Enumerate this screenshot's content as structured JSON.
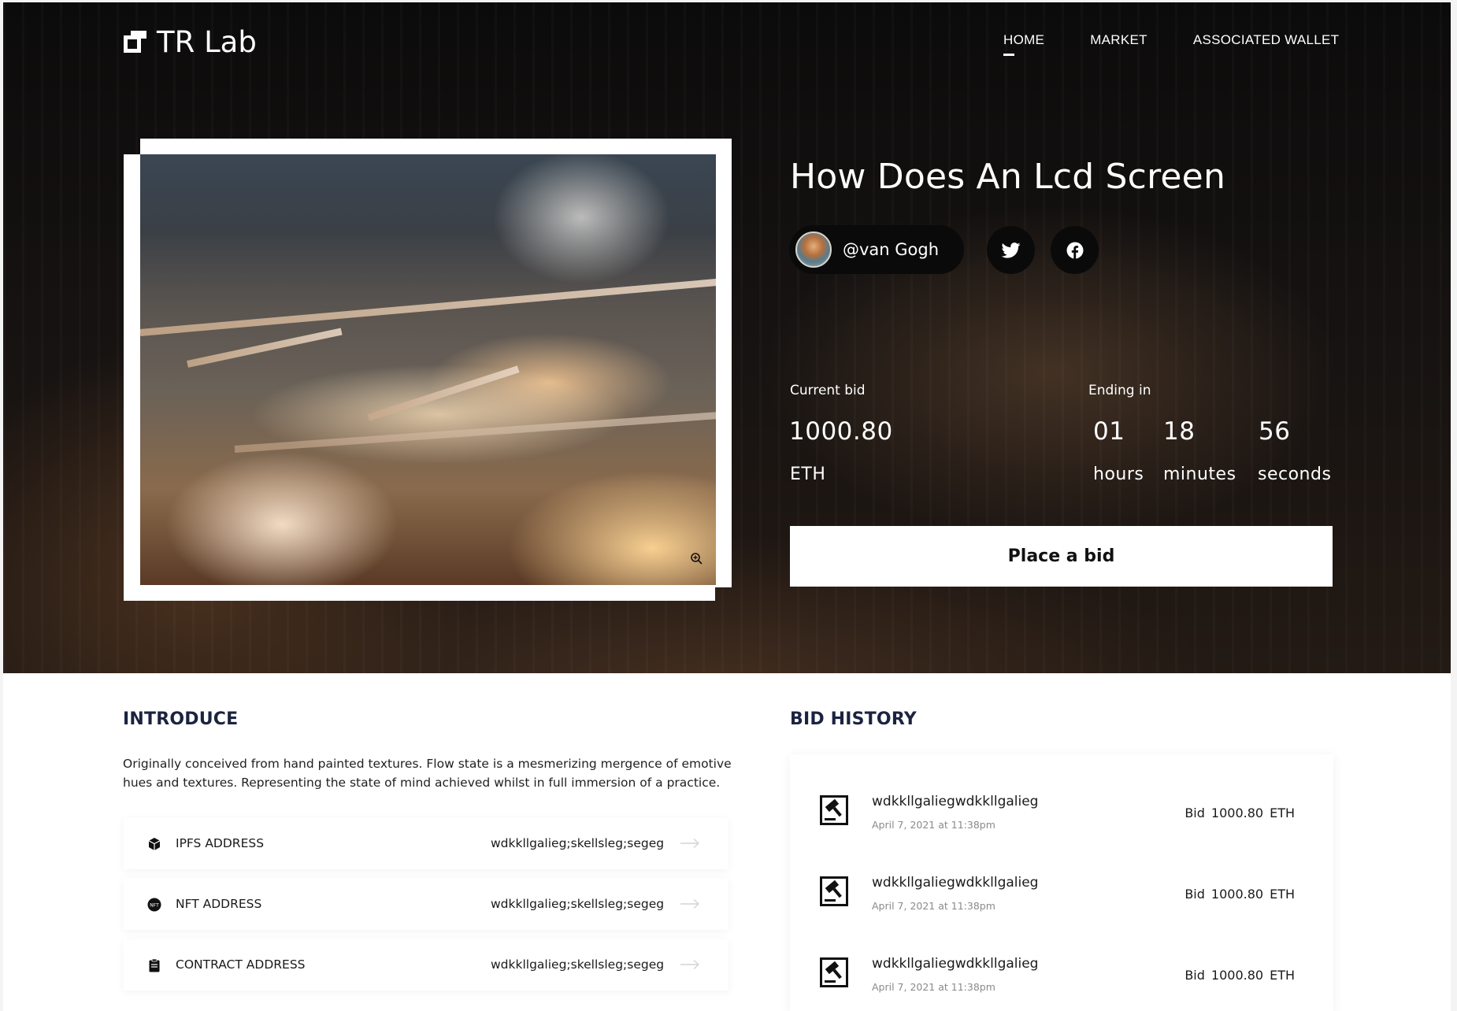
{
  "brand": {
    "name": "TR Lab"
  },
  "nav": {
    "items": [
      {
        "label": "HOME",
        "active": true
      },
      {
        "label": "MARKET",
        "active": false
      },
      {
        "label": "ASSOCIATED WALLET",
        "active": false
      }
    ]
  },
  "artwork": {
    "title": "How Does An Lcd Screen"
  },
  "author": {
    "handle": "@van Gogh"
  },
  "social": {
    "twitter_icon": "twitter-icon",
    "facebook_icon": "facebook-icon"
  },
  "auction": {
    "current_bid_label": "Current bid",
    "current_bid_value": "1000.80",
    "current_bid_unit": "ETH",
    "ending_label": "Ending in",
    "hours_value": "01",
    "hours_unit": "hours",
    "minutes_value": "18",
    "minutes_unit": "minutes",
    "seconds_value": "56",
    "seconds_unit": "seconds",
    "button_label": "Place a bid"
  },
  "introduce": {
    "heading": "INTRODUCE",
    "text": "Originally conceived from hand painted textures. Flow state is a mesmerizing mergence of emotive hues and textures. Representing the state of mind achieved whilst in full immersion of a practice.",
    "addresses": [
      {
        "icon": "cube-icon",
        "label": "IPFS ADDRESS",
        "value": "wdkkllgalieg;skellsleg;segeg"
      },
      {
        "icon": "nft-icon",
        "label": "NFT ADDRESS",
        "value": "wdkkllgalieg;skellsleg;segeg"
      },
      {
        "icon": "clipboard-icon",
        "label": "CONTRACT ADDRESS",
        "value": "wdkkllgalieg;skellsleg;segeg"
      }
    ]
  },
  "bid_history": {
    "heading": "BID HISTORY",
    "rows": [
      {
        "icon": "auction-hammer-icon",
        "name": "wdkkllgaliegwdkkllgalieg",
        "date": "April 7, 2021 at 11:38pm",
        "bid_label": "Bid",
        "amount": "1000.80",
        "unit": "ETH"
      },
      {
        "icon": "auction-hammer-icon",
        "name": "wdkkllgaliegwdkkllgalieg",
        "date": "April 7, 2021 at 11:38pm",
        "bid_label": "Bid",
        "amount": "1000.80",
        "unit": "ETH"
      },
      {
        "icon": "auction-hammer-icon",
        "name": "wdkkllgaliegwdkkllgalieg",
        "date": "April 7, 2021 at 11:38pm",
        "bid_label": "Bid",
        "amount": "1000.80",
        "unit": "ETH"
      }
    ]
  }
}
